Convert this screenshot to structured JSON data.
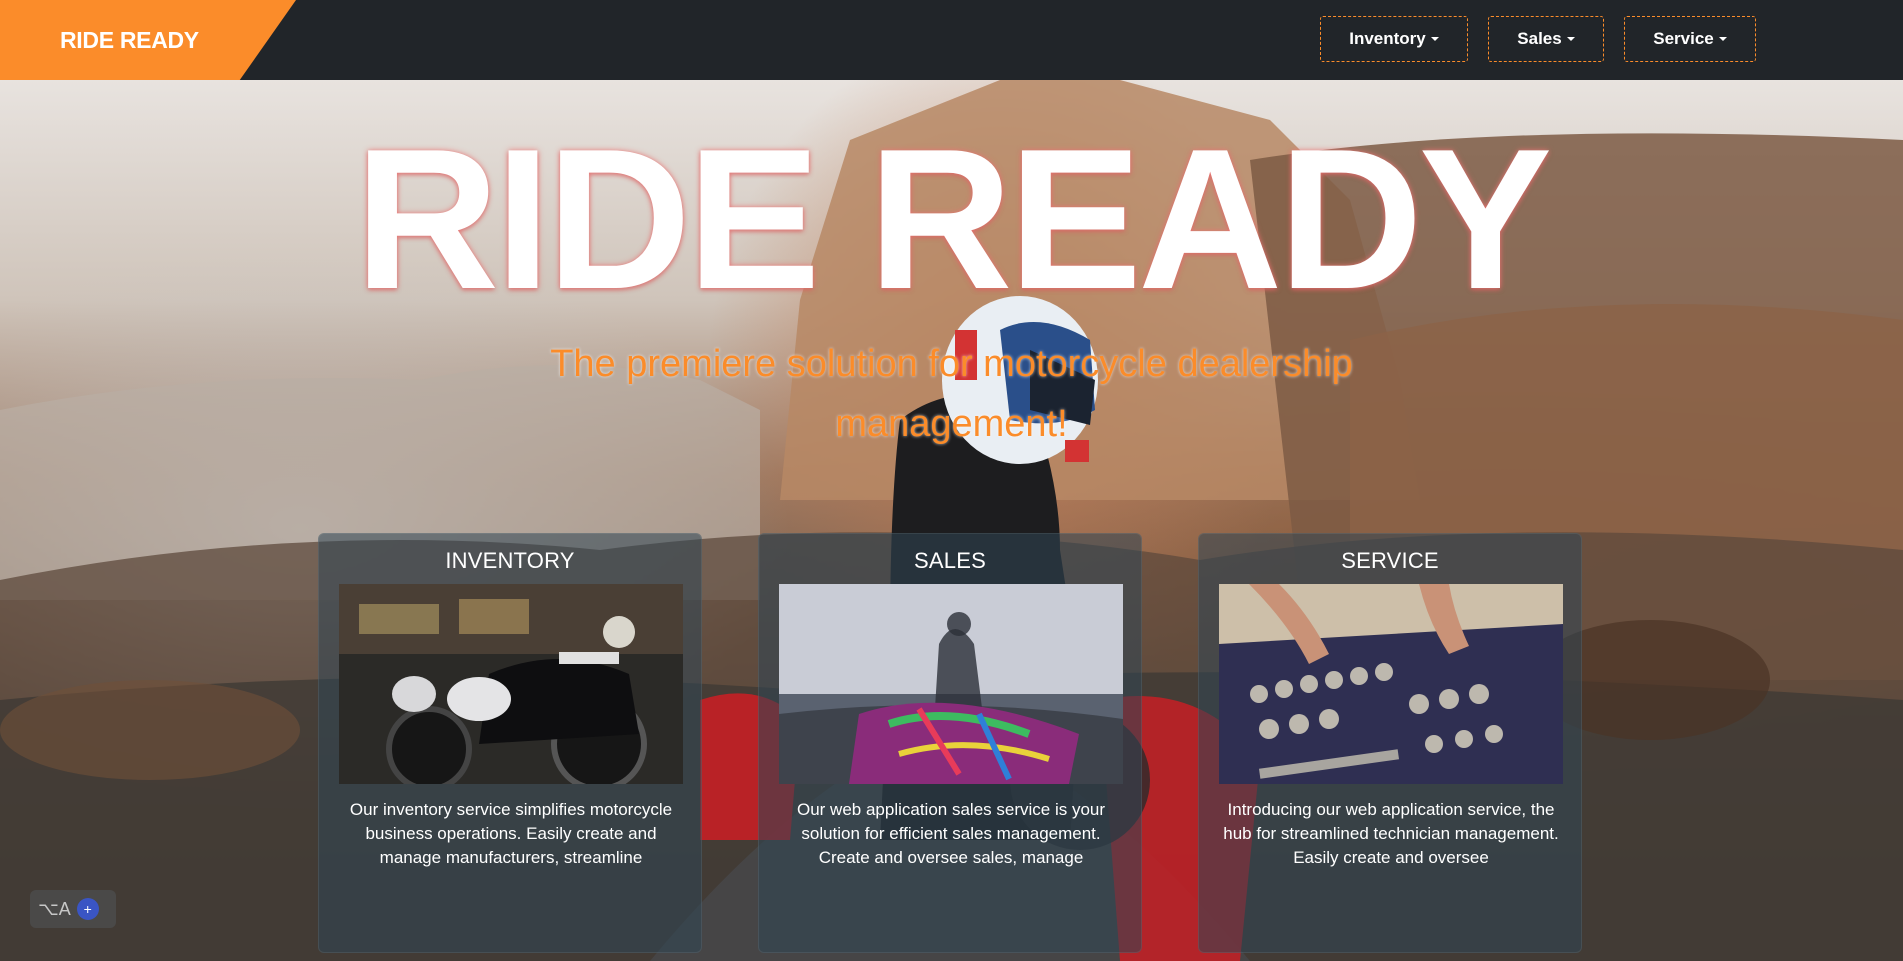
{
  "navbar": {
    "brand": "RIDE READY",
    "items": [
      {
        "label": "Inventory"
      },
      {
        "label": "Sales"
      },
      {
        "label": "Service"
      }
    ],
    "accent_color": "#fb8c2a",
    "background_color": "#212529"
  },
  "hero": {
    "title": "RIDE READY",
    "subtitle": "The premiere solution for motorcycle dealership management!"
  },
  "cards": [
    {
      "title": "INVENTORY",
      "text": "Our inventory service simplifies motorcycle business operations. Easily create and manage manufacturers, streamline"
    },
    {
      "title": "SALES",
      "text": "Our web application sales service is your solution for efficient sales management. Create and oversee sales, manage"
    },
    {
      "title": "SERVICE",
      "text": "Introducing our web application service, the hub for streamlined technician management. Easily create and oversee"
    }
  ],
  "widget": {
    "label": "⌥A"
  }
}
